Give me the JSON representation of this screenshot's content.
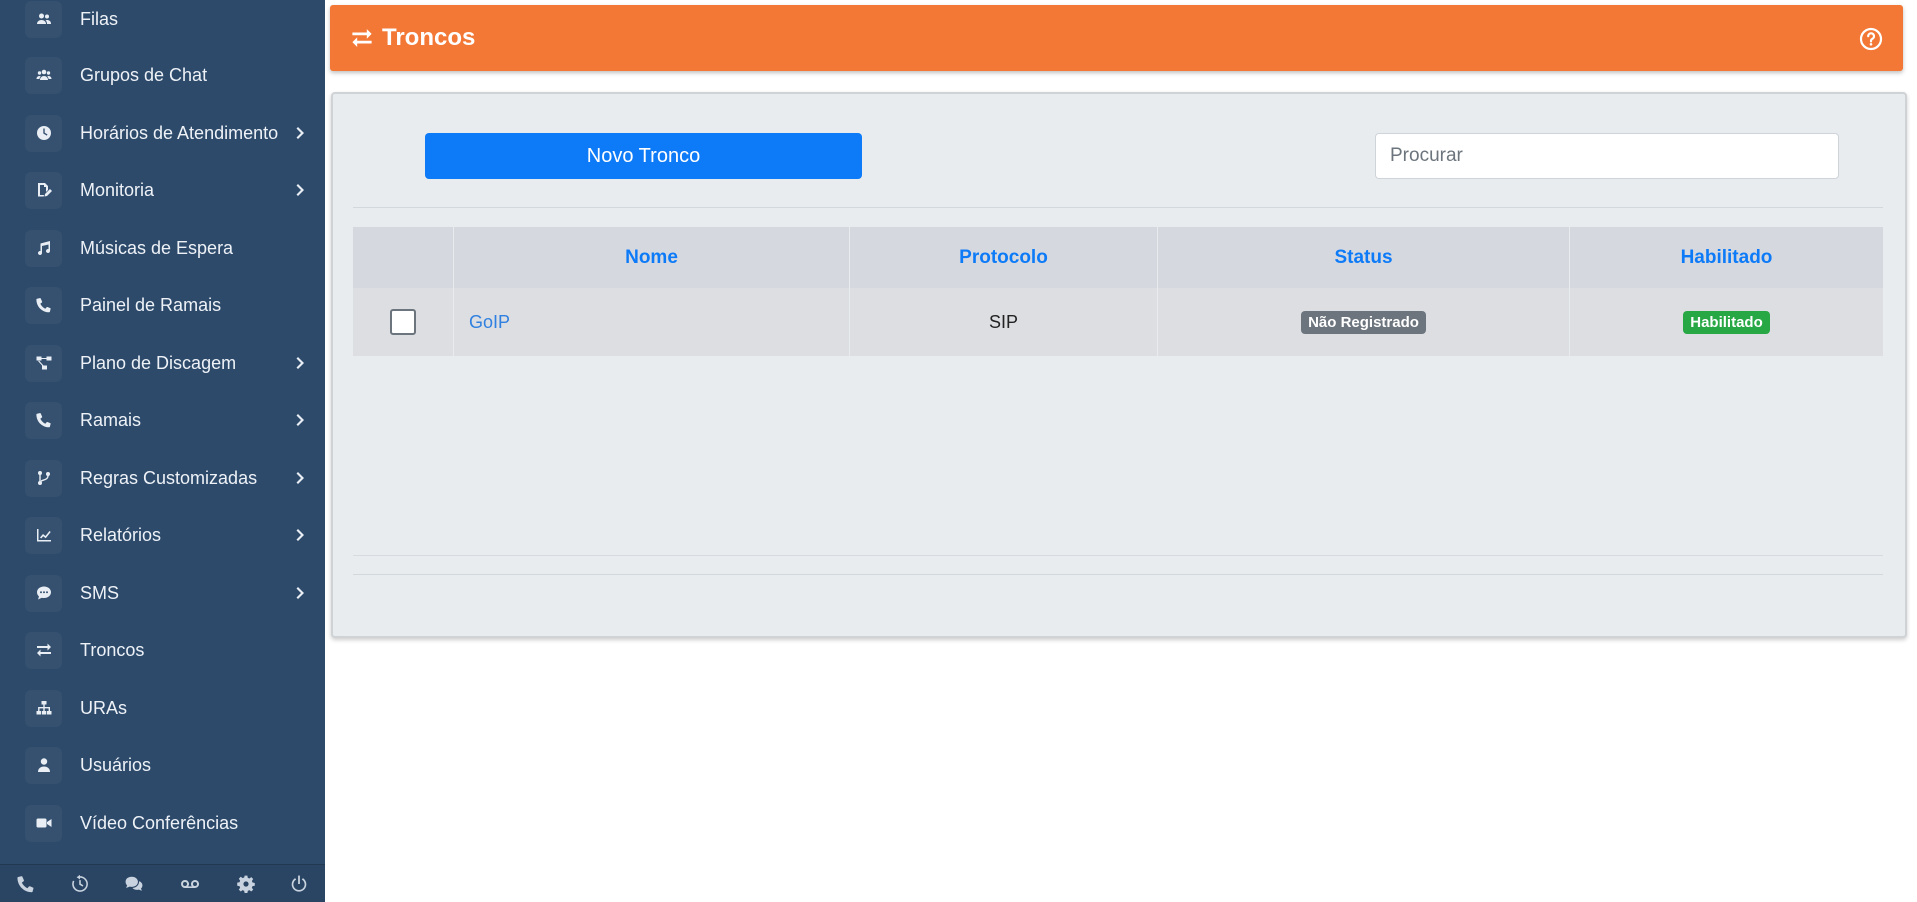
{
  "sidebar": {
    "items": [
      {
        "label": "Filas",
        "icon": "users-icon",
        "chevron": false
      },
      {
        "label": "Grupos de Chat",
        "icon": "user-group-icon",
        "chevron": false
      },
      {
        "label": "Horários de Atendimento",
        "icon": "clock-icon",
        "chevron": true
      },
      {
        "label": "Monitoria",
        "icon": "file-signature-icon",
        "chevron": true
      },
      {
        "label": "Músicas de Espera",
        "icon": "music-icon",
        "chevron": false
      },
      {
        "label": "Painel de Ramais",
        "icon": "phone-icon",
        "chevron": false
      },
      {
        "label": "Plano de Discagem",
        "icon": "project-diagram-icon",
        "chevron": true
      },
      {
        "label": "Ramais",
        "icon": "phone-icon",
        "chevron": true
      },
      {
        "label": "Regras Customizadas",
        "icon": "code-branch-icon",
        "chevron": true
      },
      {
        "label": "Relatórios",
        "icon": "chart-line-icon",
        "chevron": true
      },
      {
        "label": "SMS",
        "icon": "comment-dots-icon",
        "chevron": true
      },
      {
        "label": "Troncos",
        "icon": "exchange-icon",
        "chevron": false
      },
      {
        "label": "URAs",
        "icon": "sitemap-icon",
        "chevron": false
      },
      {
        "label": "Usuários",
        "icon": "user-icon",
        "chevron": false
      },
      {
        "label": "Vídeo Conferências",
        "icon": "video-icon",
        "chevron": false
      }
    ],
    "bottom_icons": [
      "phone-icon",
      "history-icon",
      "comments-icon",
      "voicemail-icon",
      "gear-icon",
      "power-icon"
    ]
  },
  "header": {
    "title": "Troncos",
    "icon": "exchange-icon",
    "help_icon": "question-circle-icon",
    "color": "#f37735"
  },
  "toolbar": {
    "new_button_label": "Novo Tronco",
    "search_placeholder": "Procurar"
  },
  "table": {
    "columns": [
      "",
      "Nome",
      "Protocolo",
      "Status",
      "Habilitado"
    ],
    "rows": [
      {
        "nome": "GoIP",
        "protocolo": "SIP",
        "status": "Não Registrado",
        "habilitado": "Habilitado"
      }
    ]
  },
  "colors": {
    "sidebar": "#2d4a6b",
    "accent": "#0d7bf7",
    "status_grey": "#6c757d",
    "status_green": "#28a745"
  }
}
